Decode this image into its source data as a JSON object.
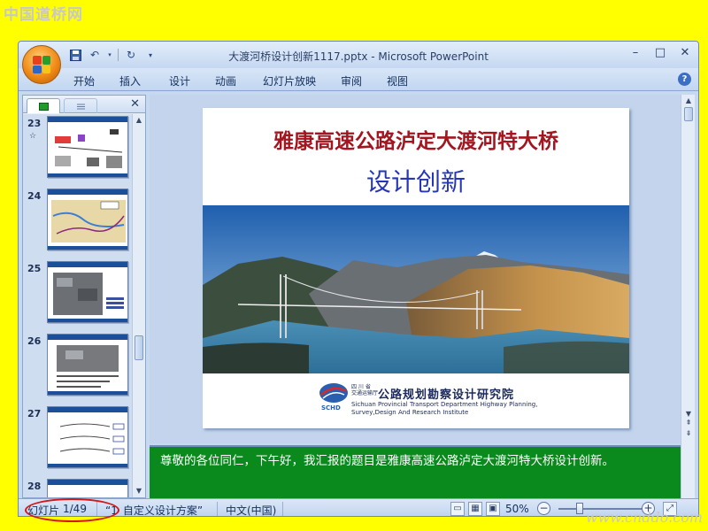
{
  "watermarks": {
    "top": "中国道桥网",
    "bottom": "www.cnddo.com"
  },
  "window": {
    "title": "大渡河桥设计创新1117.pptx - Microsoft PowerPoint",
    "controls": [
      "–",
      "□",
      "✕"
    ]
  },
  "ribbon": {
    "tabs": [
      "开始",
      "插入",
      "设计",
      "动画",
      "幻灯片放映",
      "审阅",
      "视图"
    ],
    "help": "?"
  },
  "left_panel": {
    "tabs": [
      "slides-tab",
      "outline-tab"
    ],
    "close": "✕",
    "thumbnails": [
      {
        "number": "23",
        "mark": "☆"
      },
      {
        "number": "24",
        "mark": ""
      },
      {
        "number": "25",
        "mark": ""
      },
      {
        "number": "26",
        "mark": ""
      },
      {
        "number": "27",
        "mark": ""
      },
      {
        "number": "28",
        "mark": ""
      }
    ]
  },
  "slide": {
    "title_line1": "雅康高速公路泸定大渡河特大桥",
    "title_line2": "设计创新",
    "logo": {
      "org_small": "四 川 省\n交通运输厅",
      "org_cn": "公路规划勘察设计研究院",
      "org_en_line1": "Sichuan Provincial Transport Department Highway Planning,",
      "org_en_line2": "Survey,Design And Research Institute",
      "badge": "SCHD"
    }
  },
  "notes": {
    "text": "尊敬的各位同仁，下午好，我汇报的题目是雅康高速公路泸定大渡河特大桥设计创新。"
  },
  "status_bar": {
    "slide_label": "幻灯片",
    "slide_position": "1/49",
    "theme": "“1_自定义设计方案”",
    "language": "中文(中国)",
    "zoom": "50%",
    "zoom_fraction": 0.5,
    "zoom_minus": "−",
    "zoom_plus": "+"
  },
  "colors": {
    "outer_background": "#ffff00",
    "notes_background": "#0a8a1c",
    "title_red": "#a3151f",
    "title_blue": "#2636b8",
    "annotation_red": "#d41616"
  }
}
